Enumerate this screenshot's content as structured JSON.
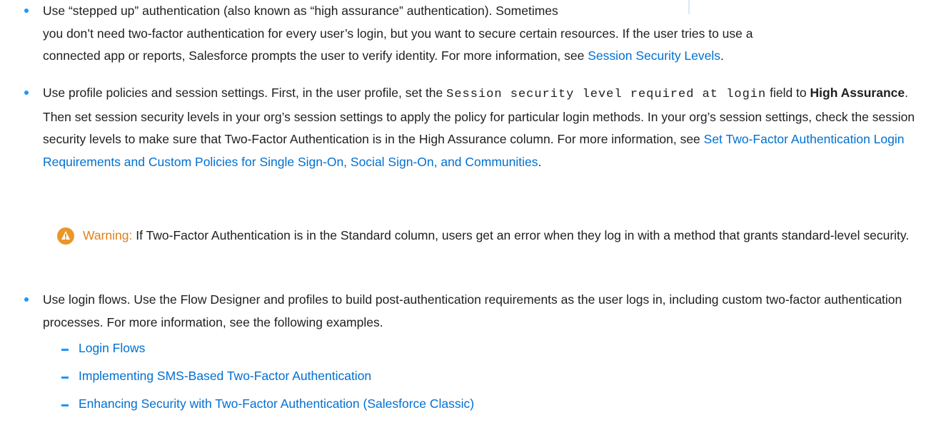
{
  "bullet1": {
    "line1": "Use “stepped up” authentication (also known as “high assurance” authentication). Sometimes",
    "line2": "you don’t need two-factor authentication for every user’s login, but you want to secure certain resources. If the user tries to use a",
    "line3_prefix": "connected app or reports, Salesforce prompts the user to verify identity. For more information, see ",
    "link": "Session Security Levels",
    "suffix": "."
  },
  "bullet2": {
    "p1": "Use profile policies and session settings. First, in the user profile, set the ",
    "code": "Session security level required at login",
    "p2": " field to ",
    "bold": "High Assurance",
    "p3": ". Then set session security levels in your org’s session settings to apply the policy for particular login methods. In your org’s session settings, check the session security levels to make sure that Two-Factor Authentication is in the High Assurance column. For more information, see ",
    "link": "Set Two-Factor Authentication Login Requirements and Custom Policies for Single Sign-On, Social Sign-On, and Communities",
    "suffix": "."
  },
  "warning": {
    "label": "Warning:",
    "text": " If Two-Factor Authentication is in the Standard column, users get an error when they log in with a method that grants standard-level security."
  },
  "bullet3": {
    "text": "Use login flows. Use the Flow Designer and profiles to build post-authentication requirements as the user logs in, including custom two-factor authentication processes. For more information, see the following examples."
  },
  "sublinks": [
    "Login Flows",
    "Implementing SMS-Based Two-Factor Authentication",
    "Enhancing Security with Two-Factor Authentication (Salesforce Classic)"
  ]
}
